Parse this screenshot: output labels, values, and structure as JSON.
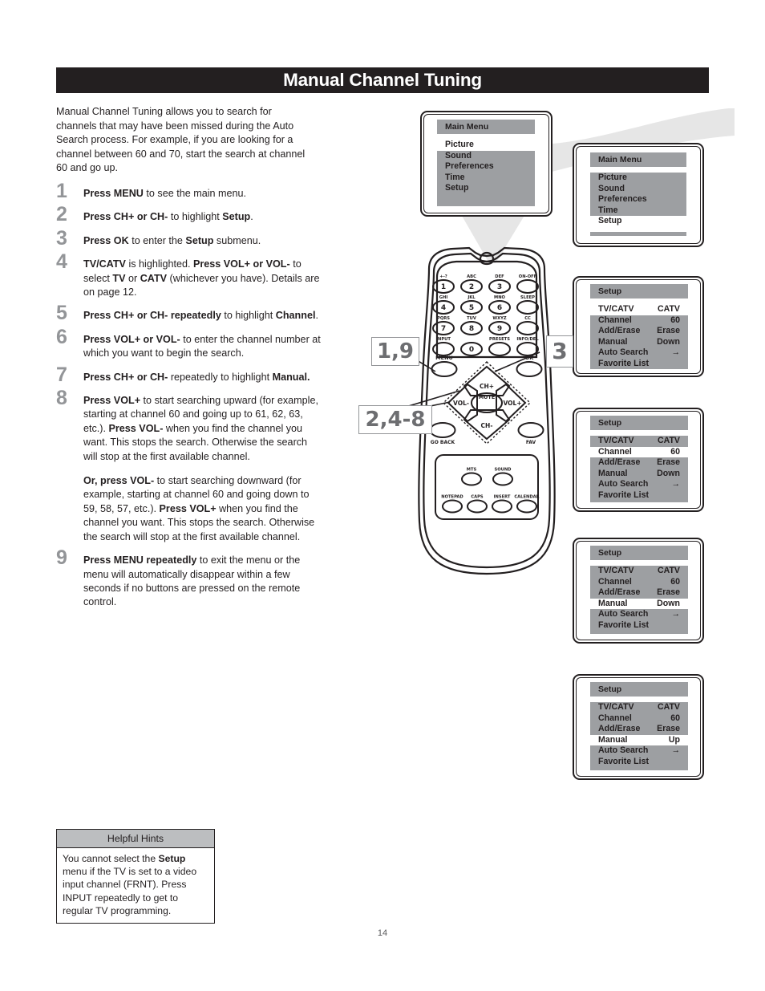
{
  "header": {
    "title": "Manual Channel Tuning"
  },
  "page_number": "14",
  "intro": "Manual Channel Tuning allows you to search for channels that may have been missed during the Auto Search process. For example, if you are looking for a channel between 60 and 70, start the search at channel 60 and go up.",
  "steps": [
    {
      "num": "1",
      "html": "<b>Press MENU</b> to see the main menu."
    },
    {
      "num": "2",
      "html": "<b>Press CH+ or CH-</b> to highlight <b>Setup</b>."
    },
    {
      "num": "3",
      "html": "<b>Press OK</b> to enter the <b>Setup</b> submenu."
    },
    {
      "num": "4",
      "html": "<b>TV/CATV</b> is highlighted. <b>Press VOL+ or VOL-</b> to select <b>TV</b> or <b>CATV</b> (whichever you have). Details are on page 12."
    },
    {
      "num": "5",
      "html": "<b>Press CH+ or CH- repeatedly</b> to highlight <b>Channel</b>."
    },
    {
      "num": "6",
      "html": "<b>Press VOL+ or VOL-</b> to enter the channel number at which you want to begin the search."
    },
    {
      "num": "7",
      "html": "<b>Press CH+ or CH-</b> repeatedly to highlight <b>Manual.</b>"
    },
    {
      "num": "8",
      "html": "<p><b>Press VOL+</b> to start searching upward (for example, starting at channel 60 and going up to 61, 62, 63, etc.). <b>Press VOL-</b> when you find the channel you want. This stops the search. Otherwise the search will stop at the first available channel.</p><p><b>Or, press VOL-</b> to start searching downward (for example, starting at channel 60 and going down to 59, 58, 57, etc.). <b>Press VOL+</b> when you find the channel you want. This stops the search. Otherwise the search will stop at the first available channel.</p>"
    },
    {
      "num": "9",
      "html": "<b>Press MENU repeatedly</b> to exit the menu or the menu will automatically disappear within a few seconds if no buttons are pressed on the remote control."
    }
  ],
  "hints": {
    "heading": "Helpful Hints",
    "html": "You cannot select the <b>Setup</b> menu if the TV is set to a video input channel (FRNT). Press INPUT repeatedly to get to regular TV programming."
  },
  "callouts": [
    {
      "id": "callout-1-9",
      "label": "1,9"
    },
    {
      "id": "callout-3",
      "label": "3"
    },
    {
      "id": "callout-2-4-8",
      "label": "2,4-8"
    }
  ],
  "screens": [
    {
      "id": "main-menu-1",
      "title": "Main Menu",
      "rows": [
        {
          "label": "Picture",
          "value": "",
          "highlight": true
        },
        {
          "label": "Sound",
          "value": "",
          "highlight": false
        },
        {
          "label": "Preferences",
          "value": "",
          "highlight": false
        },
        {
          "label": "Time",
          "value": "",
          "highlight": false
        },
        {
          "label": "Setup",
          "value": "",
          "highlight": false
        }
      ]
    },
    {
      "id": "main-menu-2",
      "title": "Main Menu",
      "rows": [
        {
          "label": "Picture",
          "value": "",
          "highlight": false
        },
        {
          "label": "Sound",
          "value": "",
          "highlight": false
        },
        {
          "label": "Preferences",
          "value": "",
          "highlight": false
        },
        {
          "label": "Time",
          "value": "",
          "highlight": false
        },
        {
          "label": "Setup",
          "value": "",
          "highlight": true
        }
      ]
    },
    {
      "id": "setup-1",
      "title": "Setup",
      "rows": [
        {
          "label": "TV/CATV",
          "value": "CATV",
          "highlight": true
        },
        {
          "label": "Channel",
          "value": "60",
          "highlight": false
        },
        {
          "label": "Add/Erase",
          "value": "Erase",
          "highlight": false
        },
        {
          "label": "Manual",
          "value": "Down",
          "highlight": false
        },
        {
          "label": "Auto Search",
          "value": "→",
          "highlight": false
        },
        {
          "label": "Favorite List",
          "value": "",
          "highlight": false
        }
      ]
    },
    {
      "id": "setup-2",
      "title": "Setup",
      "rows": [
        {
          "label": "TV/CATV",
          "value": "CATV",
          "highlight": false
        },
        {
          "label": "Channel",
          "value": "60",
          "highlight": true
        },
        {
          "label": "Add/Erase",
          "value": "Erase",
          "highlight": false
        },
        {
          "label": "Manual",
          "value": "Down",
          "highlight": false
        },
        {
          "label": "Auto Search",
          "value": "→",
          "highlight": false
        },
        {
          "label": "Favorite List",
          "value": "",
          "highlight": false
        }
      ]
    },
    {
      "id": "setup-3",
      "title": "Setup",
      "rows": [
        {
          "label": "TV/CATV",
          "value": "CATV",
          "highlight": false
        },
        {
          "label": "Channel",
          "value": "60",
          "highlight": false
        },
        {
          "label": "Add/Erase",
          "value": "Erase",
          "highlight": false
        },
        {
          "label": "Manual",
          "value": "Down",
          "highlight": true
        },
        {
          "label": "Auto Search",
          "value": "→",
          "highlight": false
        },
        {
          "label": "Favorite List",
          "value": "",
          "highlight": false
        }
      ]
    },
    {
      "id": "setup-4",
      "title": "Setup",
      "rows": [
        {
          "label": "TV/CATV",
          "value": "CATV",
          "highlight": false
        },
        {
          "label": "Channel",
          "value": "60",
          "highlight": false
        },
        {
          "label": "Add/Erase",
          "value": "Erase",
          "highlight": false
        },
        {
          "label": "Manual",
          "value": "Up",
          "highlight": true
        },
        {
          "label": "Auto Search",
          "value": "→",
          "highlight": false
        },
        {
          "label": "Favorite List",
          "value": "",
          "highlight": false
        }
      ]
    }
  ],
  "remote": {
    "keypad": [
      {
        "top": "+-?",
        "label": "1"
      },
      {
        "top": "ABC",
        "label": "2"
      },
      {
        "top": "DEF",
        "label": "3"
      },
      {
        "top": "ON-OFF",
        "label": ""
      },
      {
        "top": "GHI",
        "label": "4"
      },
      {
        "top": "JKL",
        "label": "5"
      },
      {
        "top": "MNO",
        "label": "6"
      },
      {
        "top": "SLEEP",
        "label": ""
      },
      {
        "top": "PQRS",
        "label": "7"
      },
      {
        "top": "TUV",
        "label": "8"
      },
      {
        "top": "WXYZ",
        "label": "9"
      },
      {
        "top": "CC",
        "label": ""
      },
      {
        "top": "INPUT",
        "label": ""
      },
      {
        "top": "",
        "label": "0"
      },
      {
        "top": "PRESETS",
        "label": ""
      },
      {
        "top": "INFO/DEL",
        "label": ""
      }
    ],
    "nav": {
      "menu": "MENU",
      "ok": "OK",
      "ch_up": "CH+",
      "ch_down": "CH-",
      "vol_down": "VOL-",
      "vol_up": "VOL+",
      "mute": "MUTE",
      "go_back": "GO BACK",
      "fav": "FAV"
    },
    "bottom": [
      {
        "label": "MTS"
      },
      {
        "label": "SOUND"
      },
      {
        "label": "NOTEPAD"
      },
      {
        "label": "CAPS"
      },
      {
        "label": "INSERT"
      },
      {
        "label": "CALENDAR"
      }
    ]
  },
  "colors": {
    "title_bar": "#231f20",
    "step_number": "#939598",
    "osd_grey": "#9d9fa2",
    "hint_header": "#bcbec0",
    "cone": "#e6e6e6"
  }
}
